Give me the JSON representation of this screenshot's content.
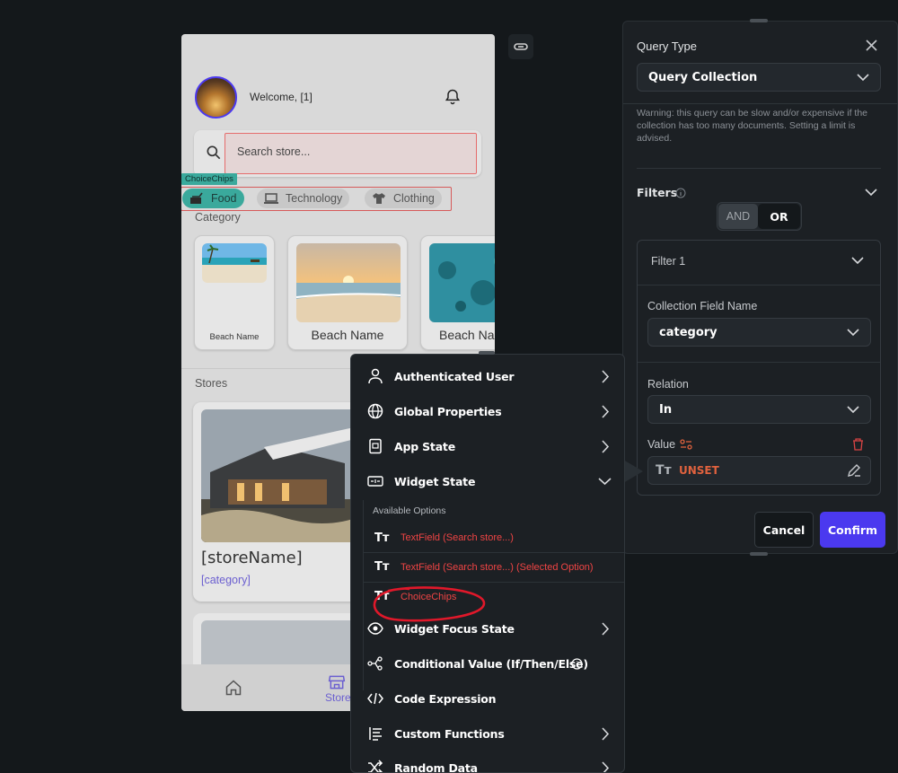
{
  "phone": {
    "welcome": "Welcome, [1]",
    "search_placeholder": "Search store...",
    "chips_tag": "ChoiceChips",
    "chips": [
      {
        "label": "Food",
        "icon": "food-icon",
        "selected": true
      },
      {
        "label": "Technology",
        "icon": "laptop-icon",
        "selected": false
      },
      {
        "label": "Clothing",
        "icon": "shirt-icon",
        "selected": false
      }
    ],
    "category_label": "Category",
    "category_cards": [
      {
        "name": "Beach Name"
      },
      {
        "name": "Beach Name"
      },
      {
        "name": "Beach Na"
      }
    ],
    "stores_label": "Stores",
    "store_card": {
      "name": "[storeName]",
      "category": "[category]"
    },
    "nav": {
      "store_label": "Store"
    }
  },
  "query_panel": {
    "query_type_label": "Query Type",
    "query_type_value": "Query Collection",
    "warning": "Warning: this query can be slow and/or expensive if the collection has too many documents. Setting a limit is advised.",
    "filters_label": "Filters",
    "logic": {
      "and": "AND",
      "or": "OR",
      "selected": "OR"
    },
    "filter_title": "Filter 1",
    "collection_field_label": "Collection Field Name",
    "collection_field_value": "category",
    "relation_label": "Relation",
    "relation_value": "In",
    "value_label": "Value",
    "value_state": "UNSET",
    "cancel": "Cancel",
    "confirm": "Confirm",
    "colors": {
      "accent": "#4b39ef",
      "unset": "#e0623e",
      "danger": "#ef4444"
    }
  },
  "menu": {
    "items_top": [
      {
        "label": "Authenticated User",
        "icon": "user-icon",
        "arrow": "right"
      },
      {
        "label": "Global Properties",
        "icon": "globe-icon",
        "arrow": "right"
      },
      {
        "label": "App State",
        "icon": "app-state-icon",
        "arrow": "right"
      },
      {
        "label": "Widget State",
        "icon": "widget-state-icon",
        "arrow": "down"
      }
    ],
    "available_options_label": "Available Options",
    "options": [
      {
        "label": "TextField (Search store...)"
      },
      {
        "label": "TextField (Search store...) (Selected Option)"
      },
      {
        "label": "ChoiceChips"
      }
    ],
    "items_bottom": [
      {
        "label": "Widget Focus State",
        "icon": "eye-icon",
        "arrow": "right"
      },
      {
        "label": "Conditional Value (If/Then/Else)",
        "icon": "branch-icon",
        "arrow": "info"
      },
      {
        "label": "Code Expression",
        "icon": "code-icon",
        "arrow": "none"
      },
      {
        "label": "Custom Functions",
        "icon": "function-icon",
        "arrow": "right"
      },
      {
        "label": "Random Data",
        "icon": "shuffle-icon",
        "arrow": "right"
      }
    ]
  }
}
